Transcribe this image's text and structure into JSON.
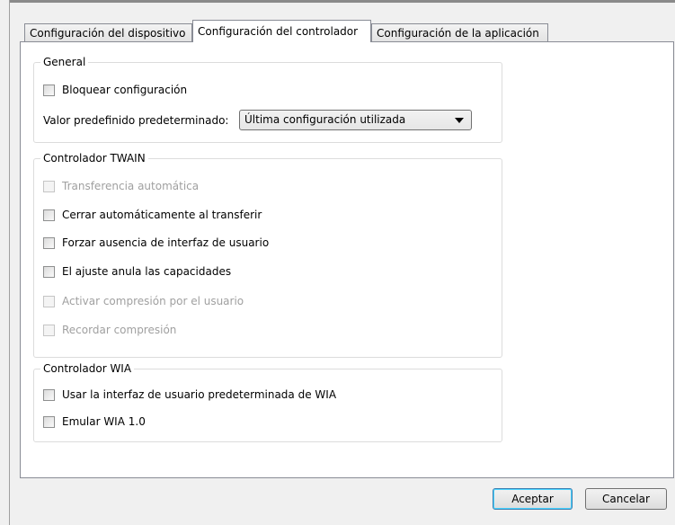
{
  "tabs": [
    {
      "label": "Configuración del dispositivo",
      "active": false
    },
    {
      "label": "Configuración del controlador",
      "active": true
    },
    {
      "label": "Configuración de la aplicación",
      "active": false
    }
  ],
  "general": {
    "title": "General",
    "lock_label": "Bloquear configuración",
    "lock_checked": false,
    "default_label": "Valor predefinido predeterminado:",
    "default_value": "Última configuración utilizada"
  },
  "twain": {
    "title": "Controlador TWAIN",
    "options": [
      {
        "label": "Transferencia automática",
        "enabled": false,
        "checked": false
      },
      {
        "label": "Cerrar automáticamente al transferir",
        "enabled": true,
        "checked": false
      },
      {
        "label": "Forzar ausencia de interfaz de usuario",
        "enabled": true,
        "checked": false
      },
      {
        "label": "El ajuste anula las capacidades",
        "enabled": true,
        "checked": false
      },
      {
        "label": "Activar compresión por el usuario",
        "enabled": false,
        "checked": false
      },
      {
        "label": "Recordar compresión",
        "enabled": false,
        "checked": false
      }
    ]
  },
  "wia": {
    "title": "Controlador WIA",
    "options": [
      {
        "label": "Usar la interfaz de usuario predeterminada de WIA",
        "enabled": true,
        "checked": false
      },
      {
        "label": "Emular WIA 1.0",
        "enabled": true,
        "checked": false
      }
    ]
  },
  "buttons": {
    "ok": "Aceptar",
    "cancel": "Cancelar"
  }
}
